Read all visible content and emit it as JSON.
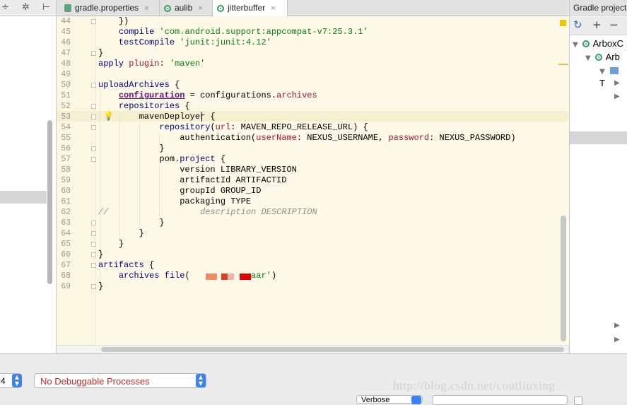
{
  "left_panel": {
    "toolbar_icons": [
      "split-icon",
      "gear-icon",
      "pin-icon"
    ],
    "toolbar_glyphs": [
      "÷",
      "✲",
      "⊢"
    ]
  },
  "tabs": [
    {
      "label": "gradle.properties",
      "icon": "gradle-icon",
      "close": "×"
    },
    {
      "label": "aulib",
      "icon": "module-icon",
      "close": "×"
    },
    {
      "label": "jitterbuffer",
      "icon": "module-icon",
      "close": "×"
    }
  ],
  "editor": {
    "line_numbers": [
      "44",
      "45",
      "46",
      "47",
      "48",
      "49",
      "50",
      "51",
      "52",
      "53",
      "54",
      "55",
      "56",
      "57",
      "58",
      "59",
      "60",
      "61",
      "62",
      "63",
      "64",
      "65",
      "66",
      "67",
      "68",
      "69"
    ],
    "lines": [
      [
        {
          "t": "    })"
        }
      ],
      [
        {
          "t": "    "
        },
        {
          "t": "compile ",
          "c": "kw"
        },
        {
          "t": "'com.android.support:appcompat-v7:25.3.1'",
          "c": "str"
        }
      ],
      [
        {
          "t": "    "
        },
        {
          "t": "testCompile ",
          "c": "kw"
        },
        {
          "t": "'junit:junit:4.12'",
          "c": "str"
        }
      ],
      [
        {
          "t": "}"
        }
      ],
      [
        {
          "t": "apply ",
          "c": "kw"
        },
        {
          "t": "plugin",
          "c": "param"
        },
        {
          "t": ": "
        },
        {
          "t": "'maven'",
          "c": "str"
        }
      ],
      [
        {
          "t": ""
        }
      ],
      [
        {
          "t": "uploadArchives ",
          "c": "kw"
        },
        {
          "t": "{"
        }
      ],
      [
        {
          "t": "    "
        },
        {
          "t": "configuration",
          "c": "bold-u"
        },
        {
          "t": " = configurations."
        },
        {
          "t": "archives",
          "c": "param"
        }
      ],
      [
        {
          "t": "    "
        },
        {
          "t": "repositories ",
          "c": "kw"
        },
        {
          "t": "{"
        }
      ],
      [
        {
          "t": "        mavenDeployer {"
        }
      ],
      [
        {
          "t": "            "
        },
        {
          "t": "repository",
          "c": "kw"
        },
        {
          "t": "("
        },
        {
          "t": "url",
          "c": "param"
        },
        {
          "t": ": MAVEN_REPO_RELEASE_URL) {"
        }
      ],
      [
        {
          "t": "                authentication("
        },
        {
          "t": "userName",
          "c": "param"
        },
        {
          "t": ": NEXUS_USERNAME, "
        },
        {
          "t": "password",
          "c": "param"
        },
        {
          "t": ": NEXUS_PASSWORD)"
        }
      ],
      [
        {
          "t": "            }"
        }
      ],
      [
        {
          "t": "            pom."
        },
        {
          "t": "project",
          "c": "kw"
        },
        {
          "t": " {"
        }
      ],
      [
        {
          "t": "                version LIBRARY_VERSION"
        }
      ],
      [
        {
          "t": "                artifactId ARTIFACTID"
        }
      ],
      [
        {
          "t": "                groupId GROUP_ID"
        }
      ],
      [
        {
          "t": "                packaging TYPE"
        }
      ],
      [
        {
          "t": "//",
          "c": "ital"
        },
        {
          "t": "                  description DESCRIPTION",
          "c": "ital"
        }
      ],
      [
        {
          "t": "            }"
        }
      ],
      [
        {
          "t": "        }"
        }
      ],
      [
        {
          "t": "    }"
        }
      ],
      [
        {
          "t": "}"
        }
      ],
      [
        {
          "t": "artifacts ",
          "c": "kw"
        },
        {
          "t": "{"
        }
      ],
      [
        {
          "t": "    "
        },
        {
          "t": "archives ",
          "c": "kw"
        },
        {
          "t": "file",
          "c": "kw"
        },
        {
          "t": "(           "
        },
        {
          "t": ".aar'",
          "c": "str"
        },
        {
          "t": ")"
        }
      ],
      [
        {
          "t": "}"
        }
      ]
    ]
  },
  "gradle_panel": {
    "title": "Gradle projects",
    "toolbar": [
      "refresh-icon",
      "add-icon",
      "remove-icon"
    ],
    "toolbar_glyphs": [
      "↻",
      "+",
      "−"
    ],
    "tree": [
      {
        "label": "ArboxC",
        "expanded": true
      },
      {
        "label": "Arb",
        "expanded": true
      },
      {
        "label": "T",
        "expanded": true
      }
    ]
  },
  "bottom": {
    "device_value": "4",
    "process_value": "No Debuggable Processes",
    "log_level_value": "Verbose",
    "watermark": "http://blog.csdn.net/coutliuxing"
  },
  "colors": {
    "editor_bg": "#fef9e7",
    "keyword": "#000080",
    "string": "#067d17",
    "param": "#a3123c",
    "error_text": "#c62828",
    "redaction_light": "#f08c6a",
    "redaction_dark": "#e60000"
  }
}
